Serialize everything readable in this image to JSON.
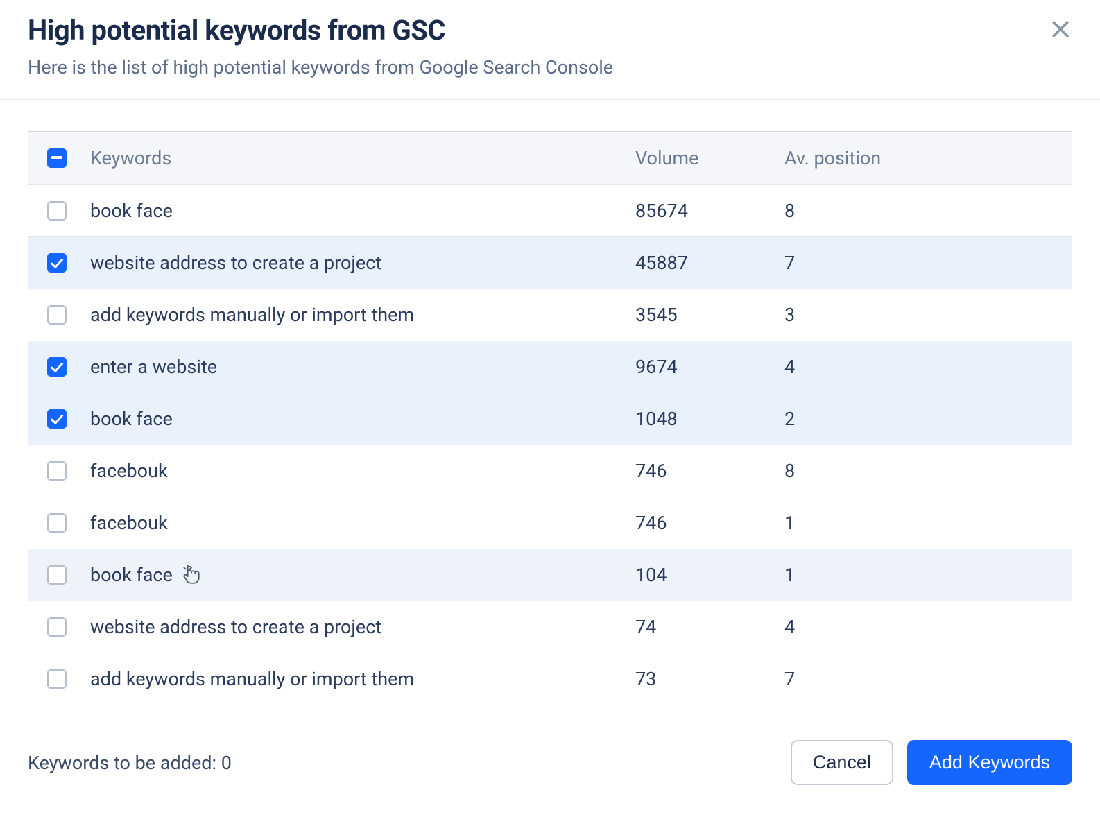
{
  "header": {
    "title": "High potential keywords from GSC",
    "subtitle": "Here is the list of high potential keywords from Google Search Console"
  },
  "table": {
    "columns": {
      "keywords": "Keywords",
      "volume": "Volume",
      "position": "Av. position"
    },
    "rows": [
      {
        "keyword": "book face",
        "volume": "85674",
        "position": "8",
        "checked": false,
        "hovered": false
      },
      {
        "keyword": "website address to create a project",
        "volume": "45887",
        "position": "7",
        "checked": true,
        "hovered": false
      },
      {
        "keyword": "add keywords manually or import them",
        "volume": "3545",
        "position": "3",
        "checked": false,
        "hovered": false
      },
      {
        "keyword": "enter a website",
        "volume": "9674",
        "position": "4",
        "checked": true,
        "hovered": false
      },
      {
        "keyword": "book face",
        "volume": "1048",
        "position": "2",
        "checked": true,
        "hovered": false
      },
      {
        "keyword": "facebouk",
        "volume": "746",
        "position": "8",
        "checked": false,
        "hovered": false
      },
      {
        "keyword": "facebouk",
        "volume": "746",
        "position": "1",
        "checked": false,
        "hovered": false
      },
      {
        "keyword": "book face",
        "volume": "104",
        "position": "1",
        "checked": false,
        "hovered": true
      },
      {
        "keyword": "website address to create a project",
        "volume": "74",
        "position": "4",
        "checked": false,
        "hovered": false
      },
      {
        "keyword": "add keywords manually or import them",
        "volume": "73",
        "position": "7",
        "checked": false,
        "hovered": false
      }
    ]
  },
  "footer": {
    "label_prefix": "Keywords to be added: ",
    "count": "0",
    "cancel": "Cancel",
    "add": "Add Keywords"
  }
}
